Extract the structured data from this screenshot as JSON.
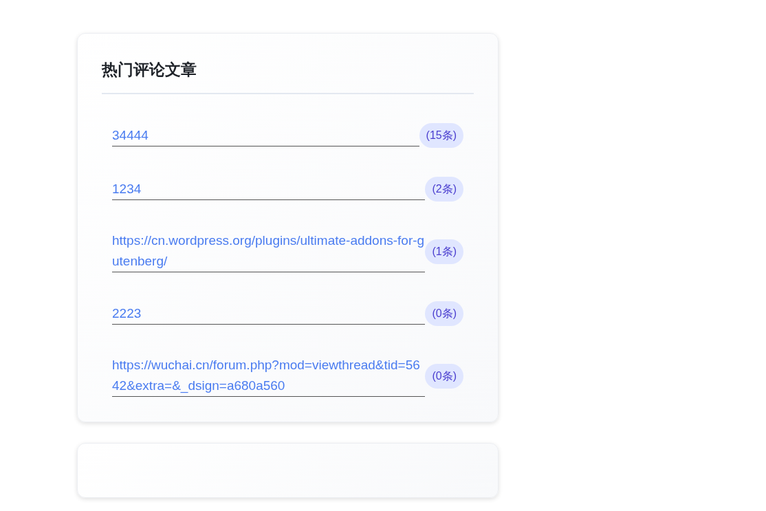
{
  "widget": {
    "title": "热门评论文章",
    "articles": [
      {
        "link": "34444",
        "count": "(15条)"
      },
      {
        "link": "1234",
        "count": "(2条)"
      },
      {
        "link": "https://cn.wordpress.org/plugins/ultimate-addons-for-gutenberg/",
        "count": "(1条)"
      },
      {
        "link": "2223",
        "count": "(0条)"
      },
      {
        "link": "https://wuchai.cn/forum.php?mod=viewthread&tid=5642&extra=&_dsign=a680a560",
        "count": "(0条)"
      }
    ]
  }
}
